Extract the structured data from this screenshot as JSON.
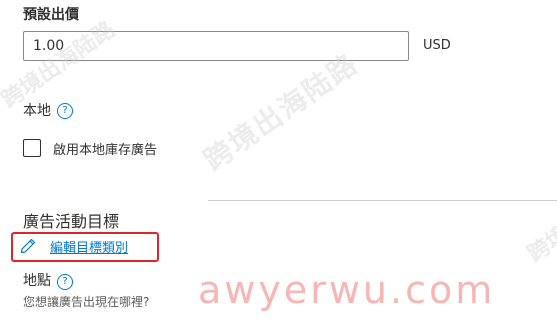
{
  "bid": {
    "label": "預設出價",
    "value": "1.00",
    "currency": "USD"
  },
  "local": {
    "label": "本地",
    "help_icon": "question-circle-icon",
    "checkbox_label": "啟用本地庫存廣告",
    "checked": false
  },
  "campaign_goal": {
    "heading": "廣告活動目標",
    "edit_icon": "pencil-icon",
    "edit_link": "編輯目標類別"
  },
  "location": {
    "label": "地點",
    "help_icon": "question-circle-icon",
    "question": "您想讓廣告出現在哪裡?"
  },
  "watermark": {
    "text": "跨境出海陆路",
    "url": "awyerwu.com"
  },
  "colors": {
    "link": "#0078d4",
    "highlight": "#e0242b",
    "watermark_url": "#f07878"
  }
}
